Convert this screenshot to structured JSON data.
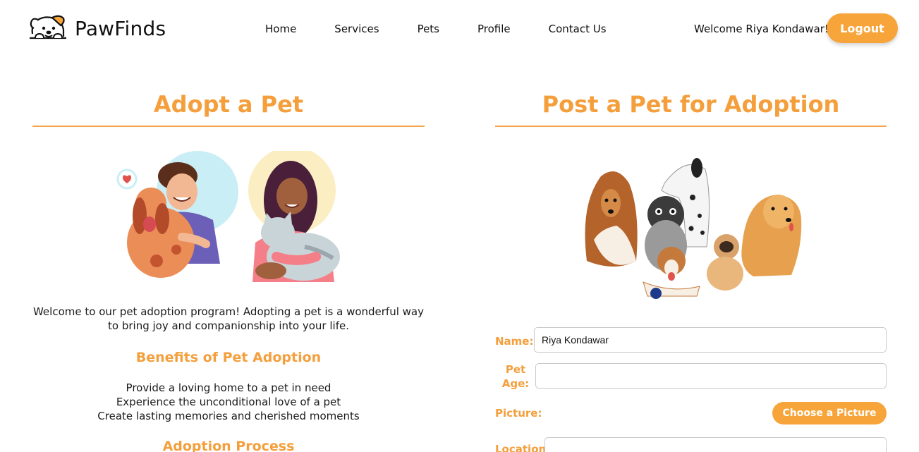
{
  "brand": {
    "name": "PawFinds",
    "logo_icon": "dog-peeking-logo-icon"
  },
  "nav": {
    "items": [
      "Home",
      "Services",
      "Pets",
      "Profile",
      "Contact Us"
    ]
  },
  "user": {
    "welcome_text": "Welcome Riya Kondawar!",
    "logout_label": "Logout"
  },
  "adopt": {
    "title": "Adopt a Pet",
    "intro": "Welcome to our pet adoption program! Adopting a pet is a wonderful way to bring joy and companionship into your life.",
    "benefits_title": "Benefits of Pet Adoption",
    "benefits": [
      "Provide a loving home to a pet in need",
      "Experience the unconditional love of a pet",
      "Create lasting memories and cherished moments"
    ],
    "process_title": "Adoption Process"
  },
  "post": {
    "title": "Post a Pet for Adoption",
    "form": {
      "name_label": "Name:",
      "name_value": "Riya Kondawar",
      "age_label": "Pet Age:",
      "age_value": "",
      "picture_label": "Picture:",
      "picture_button": "Choose a Picture",
      "location_label": "Location:"
    }
  },
  "colors": {
    "accent": "#f7a53a",
    "heading": "#f49f3c"
  }
}
